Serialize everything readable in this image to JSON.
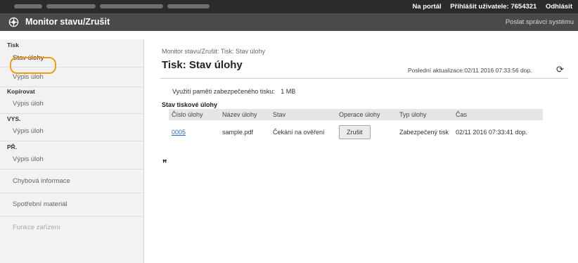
{
  "topbar": {
    "portal": "Na portál",
    "user": "Přihlášit uživatele: 7654321",
    "logout": "Odhlásit"
  },
  "header": {
    "title": "Monitor stavu/Zrušit",
    "send_admin": "Poslat správci systému"
  },
  "sidebar": {
    "sections": [
      {
        "heading": "Tisk",
        "items": [
          "Stav úlohy",
          "Výpis úloh"
        ]
      },
      {
        "heading": "Kopírovat",
        "items": [
          "Výpis úloh"
        ]
      },
      {
        "heading": "VYS.",
        "items": [
          "Výpis úloh"
        ]
      },
      {
        "heading": "PŘ.",
        "items": [
          "Výpis úloh"
        ]
      }
    ],
    "extra_items": [
      "Chybová informace",
      "Spotřební materiál",
      "Funkce zařízení"
    ]
  },
  "main": {
    "breadcrumb": "Monitor stavu/Zrušit: Tisk: Stav úlohy",
    "title": "Tisk: Stav úlohy",
    "last_update": "Poslední aktualizace:02/11 2016 07:33:56 dop.",
    "memory_label": "Využití paměti zabezpečeného tisku:",
    "memory_value": "1 MB",
    "table_title": "Stav tiskové úlohy",
    "columns": [
      "Číslo úlohy",
      "Název úlohy",
      "Stav",
      "Operace úlohy",
      "Typ úlohy",
      "Čas"
    ],
    "rows": [
      {
        "id": "0005",
        "name": "sample.pdf",
        "status": "Čekání na ověření",
        "action": "Zrušit",
        "type": "Zabezpečený tisk",
        "time": "02/11 2016 07:33:41 dop."
      }
    ],
    "zoom_mark": "ꟸ"
  }
}
